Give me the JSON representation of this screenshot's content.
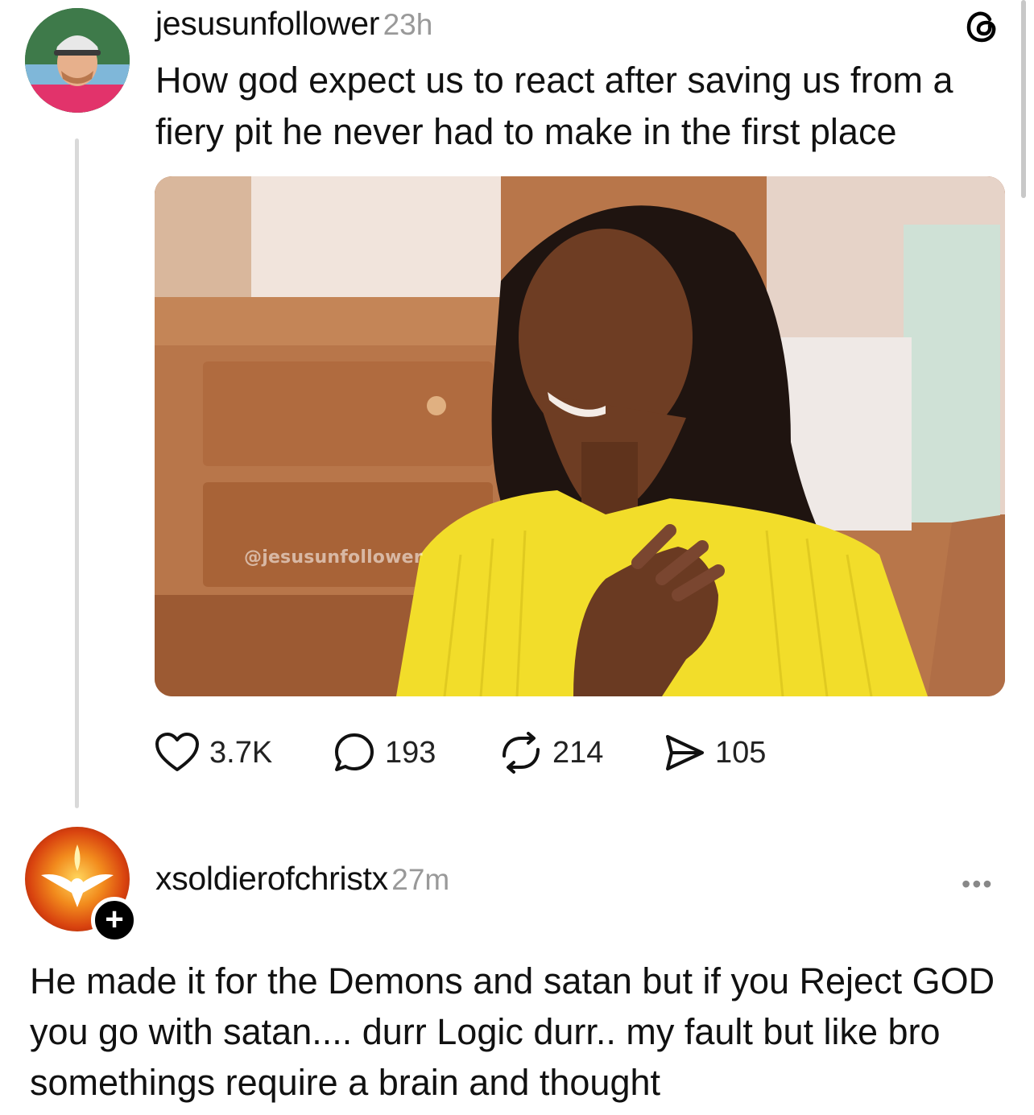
{
  "post": {
    "username": "jesusunfollower",
    "time": "23h",
    "text": "How god expect us to react after saving us from a fiery pit he never had to make in the first place",
    "image_watermark": "@jesusunfollower",
    "icons": {
      "app_logo": "threads-logo-icon"
    },
    "stats": {
      "likes": "3.7K",
      "replies": "193",
      "reposts": "214",
      "shares": "105"
    }
  },
  "reply": {
    "username": "xsoldierofchristx",
    "time": "27m",
    "follow_badge": "+",
    "more_label": "•••",
    "text": "He made it for the Demons and satan but if you Reject GOD you go with satan.... durr Logic durr.. my fault but like bro somethings require a brain and thought"
  },
  "colors": {
    "text": "#111111",
    "muted": "#999999",
    "thread_line": "#d9d9d9",
    "sweater_yellow": "#f2dd2a"
  }
}
